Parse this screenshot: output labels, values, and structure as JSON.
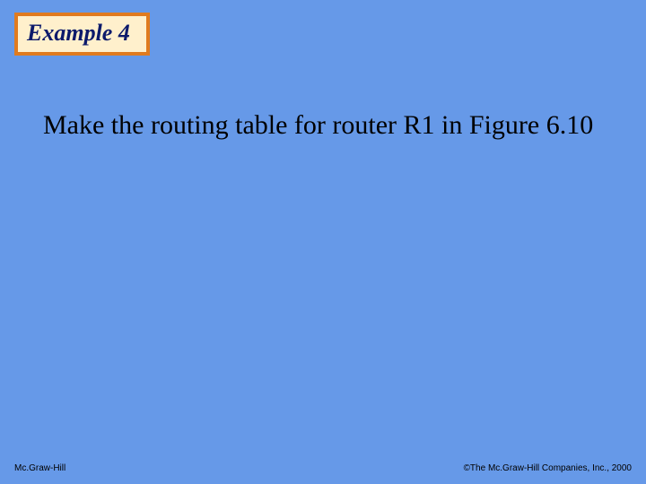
{
  "title": "Example 4",
  "body": "Make the routing table for router R1 in Figure 6.10",
  "footer_left": "Mc.Graw-Hill",
  "footer_right": "©The Mc.Graw-Hill Companies, Inc., 2000"
}
